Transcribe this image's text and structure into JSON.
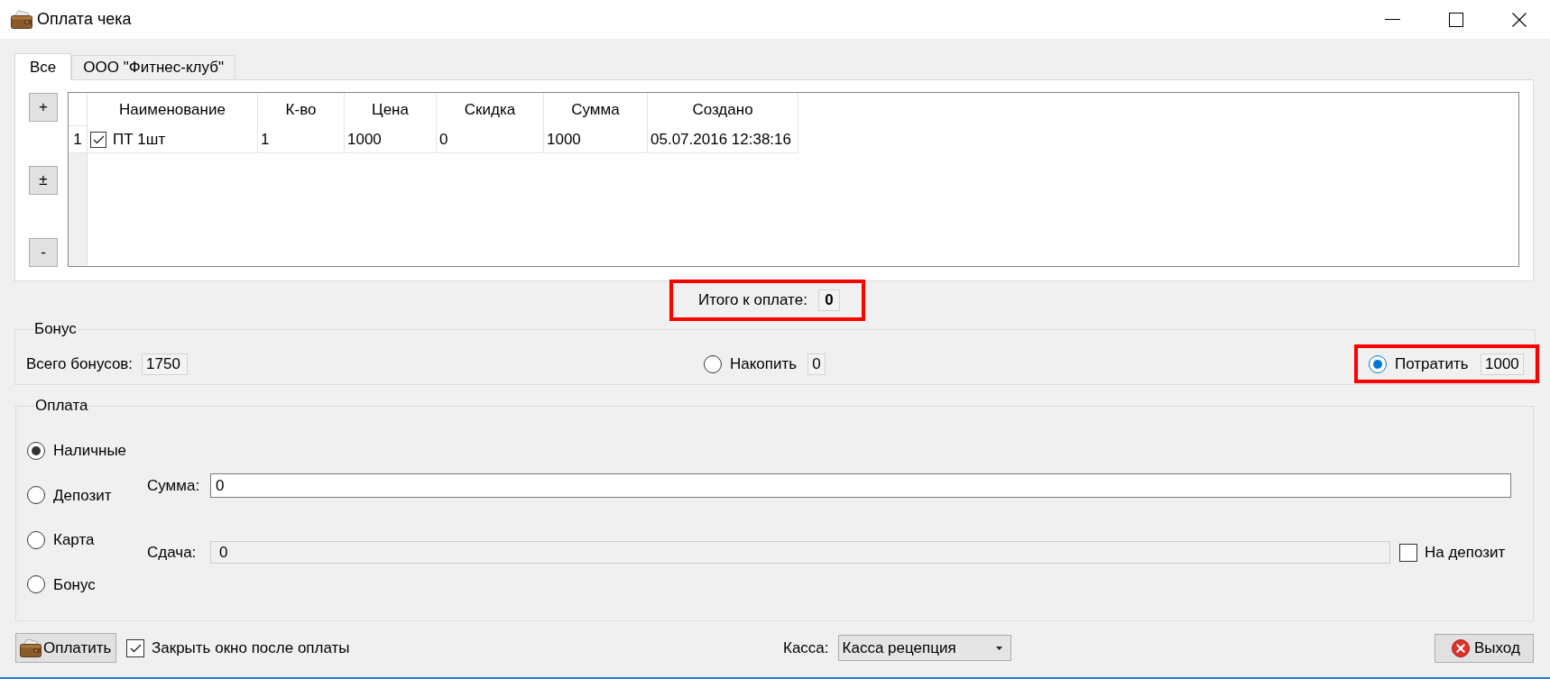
{
  "window": {
    "title": "Оплата чека"
  },
  "tabs": [
    {
      "label": "Все",
      "selected": true
    },
    {
      "label": "ООО \"Фитнес-клуб\"",
      "selected": false
    }
  ],
  "row_buttons": [
    "+",
    "±",
    "-"
  ],
  "table": {
    "columns": [
      "Наименование",
      "К-во",
      "Цена",
      "Скидка",
      "Сумма",
      "Создано"
    ],
    "rows": [
      {
        "number": "1",
        "checked": true,
        "cells": [
          "ПТ 1шт",
          "1",
          "1000",
          "0",
          "1000",
          "05.07.2016 12:38:16"
        ]
      }
    ]
  },
  "total": {
    "label": "Итого к оплате:",
    "value": "0",
    "highlighted": true
  },
  "bonus": {
    "title": "Бонус",
    "total_label": "Всего бонусов:",
    "total_value": "1750",
    "options": [
      {
        "label": "Накопить",
        "value": "0",
        "selected": false,
        "focused": false,
        "highlighted": false
      },
      {
        "label": "Потратить",
        "value": "1000",
        "selected": true,
        "focused": true,
        "highlighted": true
      }
    ]
  },
  "payment": {
    "title": "Оплата",
    "methods": [
      {
        "label": "Наличные",
        "selected": true
      },
      {
        "label": "Депозит",
        "selected": false
      },
      {
        "label": "Карта",
        "selected": false
      },
      {
        "label": "Бонус",
        "selected": false
      }
    ],
    "amount": {
      "label": "Сумма:",
      "value": "0",
      "disabled": false
    },
    "change": {
      "label": "Сдача:",
      "value": "0",
      "disabled": true
    },
    "to_deposit": {
      "label": "На депозит",
      "checked": false
    }
  },
  "footer": {
    "pay_button": "Оплатить",
    "close_after": {
      "label": "Закрыть окно после оплаты",
      "checked": true
    },
    "register": {
      "label": "Касса:",
      "value": "Касса рецепция"
    },
    "exit_button": "Выход"
  }
}
